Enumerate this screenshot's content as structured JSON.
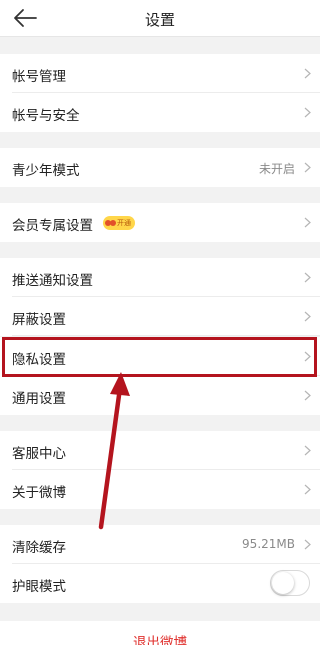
{
  "header": {
    "title": "设置"
  },
  "rows": {
    "account_manage": {
      "label": "帐号管理"
    },
    "account_security": {
      "label": "帐号与安全"
    },
    "teen_mode": {
      "label": "青少年模式",
      "value": "未开启"
    },
    "vip_settings": {
      "label": "会员专属设置",
      "badge": "开通"
    },
    "push": {
      "label": "推送通知设置"
    },
    "block": {
      "label": "屏蔽设置"
    },
    "privacy": {
      "label": "隐私设置"
    },
    "general": {
      "label": "通用设置"
    },
    "service": {
      "label": "客服中心"
    },
    "about": {
      "label": "关于微博"
    },
    "clear_cache": {
      "label": "清除缓存",
      "value": "95.21MB"
    },
    "eye_mode": {
      "label": "护眼模式",
      "enabled": false
    }
  },
  "logout": {
    "label": "退出微博"
  },
  "colors": {
    "annotation": "#b4141e",
    "logout_text": "#e0322f",
    "vip_badge": "#ffd64a"
  }
}
